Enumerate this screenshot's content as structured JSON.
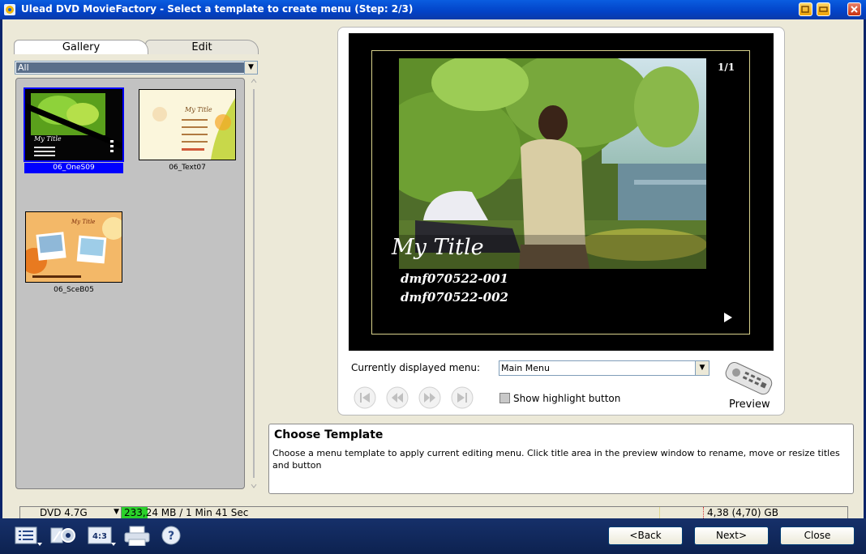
{
  "window": {
    "title": "Ulead DVD MovieFactory - Select a template to create menu (Step: 2/3)"
  },
  "left_panel": {
    "tabs": [
      "Gallery",
      "Edit"
    ],
    "filter_value": "All",
    "templates": [
      {
        "label": "06_OneS09",
        "selected": true,
        "thumb_title": "My Title"
      },
      {
        "label": "06_Text07",
        "selected": false,
        "thumb_title": "My Title"
      },
      {
        "label": "06_SceB05",
        "selected": false,
        "thumb_title": "My Title"
      }
    ]
  },
  "preview": {
    "page_indicator": "1/1",
    "menu_title": "My Title",
    "menu_items": [
      "dmf070522-001",
      "dmf070522-002"
    ],
    "current_menu_label": "Currently displayed menu:",
    "current_menu_value": "Main Menu",
    "show_highlight_label": "Show highlight button",
    "preview_label": "Preview"
  },
  "info": {
    "title": "Choose Template",
    "body": "Choose a menu template to apply current editing menu. Click title area in the preview window to rename, move or resize titles and button"
  },
  "capacity": {
    "disc_type": "DVD 4.7G",
    "used_text": "233,24 MB / 1 Min 41 Sec",
    "free_text": "4,38 (4,70) GB",
    "used_fraction": 0.036
  },
  "buttons": {
    "back": "<Back",
    "next": "Next>",
    "close": "Close"
  },
  "icons": [
    "menu-list-icon",
    "settings-icon",
    "aspect-ratio-icon",
    "print-icon",
    "help-icon",
    "remote-control-icon"
  ],
  "colors": {
    "titlebar": "#0a5de0",
    "selection": "#0000ff",
    "used_bar": "#2ad12a",
    "bottom_bar": "#16306a"
  }
}
